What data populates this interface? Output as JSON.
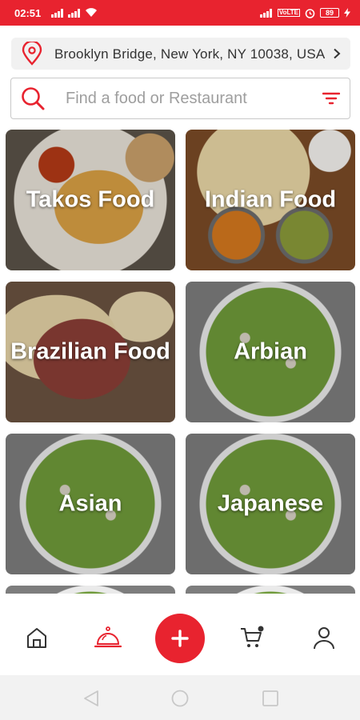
{
  "status_bar": {
    "time": "02:51",
    "volte": "VoLTE",
    "battery": "89"
  },
  "location": {
    "address": "Brooklyn Bridge, New York, NY 10038, USA"
  },
  "search": {
    "placeholder": "Find a food or Restaurant"
  },
  "categories": [
    {
      "label": "Takos Food"
    },
    {
      "label": "Indian Food"
    },
    {
      "label": "Brazilian Food"
    },
    {
      "label": "Arbian"
    },
    {
      "label": "Asian"
    },
    {
      "label": "Japanese"
    }
  ],
  "bottom_nav": {
    "items": [
      "home-icon",
      "food-cloche-icon",
      "add-icon",
      "cart-icon",
      "profile-icon"
    ],
    "active": "food-cloche-icon"
  },
  "colors": {
    "accent": "#e8232f"
  }
}
